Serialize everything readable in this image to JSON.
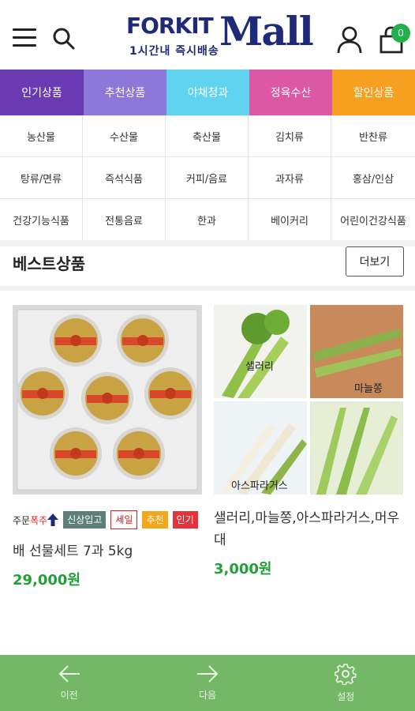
{
  "header": {
    "logo_text_top": "FORKIT",
    "logo_text_mall": "Mall",
    "logo_subtitle": "1시간내 즉시배송",
    "cart_count": "0"
  },
  "tabs": [
    {
      "label": "인기상품",
      "color": "#6a3ab2"
    },
    {
      "label": "추천상품",
      "color": "#8b78d8"
    },
    {
      "label": "야채청과",
      "color": "#5fd3ef"
    },
    {
      "label": "정육수산",
      "color": "#dd58a4"
    },
    {
      "label": "할인상품",
      "color": "#f79f1f"
    }
  ],
  "categories": [
    "농산물",
    "수산물",
    "축산물",
    "김치류",
    "반찬류",
    "탕류/면류",
    "즉석식품",
    "커피/음료",
    "과자류",
    "홍삼/인삼",
    "건강기능식품",
    "전통음료",
    "한과",
    "베이커리",
    "어린이건강식품"
  ],
  "best": {
    "title": "베스트상품",
    "more_label": "더보기"
  },
  "products": [
    {
      "hot_prefix": "주문",
      "hot_word": "폭주",
      "tags": [
        "신상입고",
        "세일",
        "추천",
        "인기"
      ],
      "name": "배 선물세트 7과 5kg",
      "price": "29,000원"
    },
    {
      "image_labels": [
        "샐러리",
        "마늘쫑",
        "아스파라거스"
      ],
      "name": "샐러리,마늘쫑,아스파라거스,머우대",
      "price": "3,000원"
    }
  ],
  "bottom_nav": [
    {
      "label": "이전",
      "icon": "arrow-left-icon"
    },
    {
      "label": "다음",
      "icon": "arrow-right-icon"
    },
    {
      "label": "설정",
      "icon": "gear-icon"
    }
  ]
}
